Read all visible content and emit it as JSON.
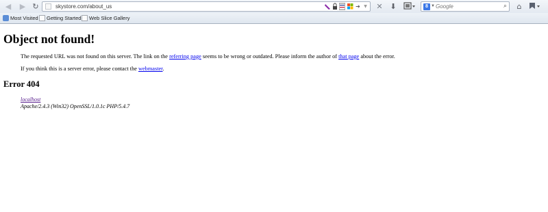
{
  "toolbar": {
    "back_glyph": "◀",
    "forward_glyph": "▶",
    "reload_glyph": "↻",
    "url": "skystore.com/about_us",
    "search": {
      "placeholder": "Google",
      "engine_letter": "8"
    },
    "icons": [
      "favicon-icon",
      "addon-icon",
      "lock-icon",
      "flag-icon",
      "windows-icon",
      "go-arrow-icon",
      "dropdown-icon",
      "stop-icon",
      "download-icon",
      "library-icon",
      "home-icon",
      "bookmark-menu-icon"
    ]
  },
  "bookmarks": [
    {
      "label": "Most Visited",
      "icon": "most-visited-icon"
    },
    {
      "label": "Getting Started",
      "icon": "page-icon"
    },
    {
      "label": "Web Slice Gallery",
      "icon": "page-icon"
    }
  ],
  "page": {
    "heading": "Object not found!",
    "para1": {
      "t1": "The requested URL was not found on this server. The link on the ",
      "link1": "referring page",
      "t2": " seems to be wrong or outdated. Please inform the author of ",
      "link2": "that page",
      "t3": " about the error."
    },
    "para2": {
      "t1": "If you think this is a server error, please contact the ",
      "link": "webmaster",
      "t2": "."
    },
    "error_heading": "Error 404",
    "address": {
      "host": "localhost",
      "server": "Apache/2.4.3 (Win32) OpenSSL/1.0.1c PHP/5.4.7"
    }
  },
  "colors": {
    "link": "#0000ee",
    "visited_link": "#551a8b",
    "toolbar_bg": "#e3e9f1"
  }
}
